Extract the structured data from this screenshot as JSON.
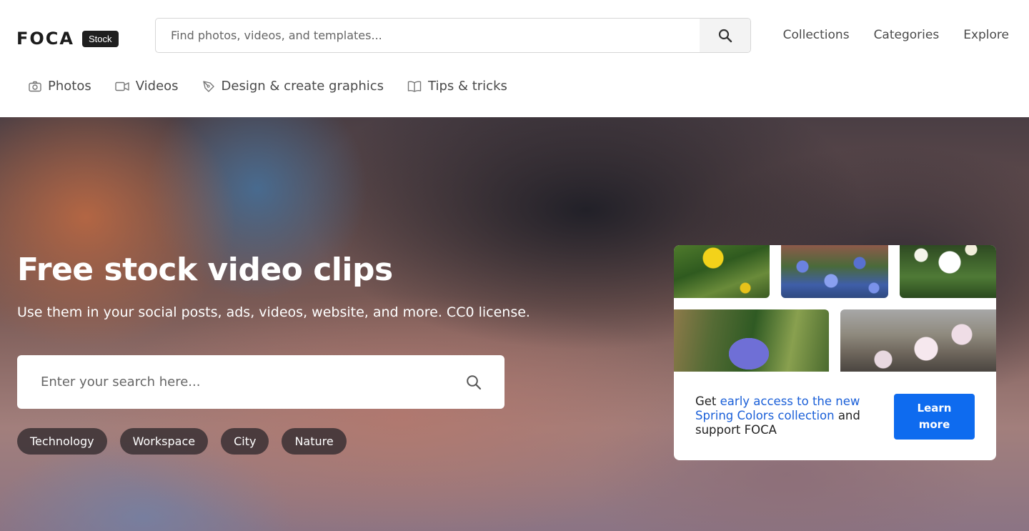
{
  "header": {
    "logo_text": "FOCA",
    "logo_badge": "Stock",
    "search_placeholder": "Find photos, videos, and templates...",
    "nav": [
      "Collections",
      "Categories",
      "Explore"
    ],
    "subnav": [
      {
        "label": "Photos",
        "icon": "camera-icon"
      },
      {
        "label": "Videos",
        "icon": "video-icon"
      },
      {
        "label": "Design & create graphics",
        "icon": "pen-icon"
      },
      {
        "label": "Tips & tricks",
        "icon": "book-icon"
      }
    ]
  },
  "hero": {
    "title": "Free stock video clips",
    "subtitle": "Use them in your social posts, ads, videos, website, and more. CC0 license.",
    "search_placeholder": "Enter your search here...",
    "tags": [
      "Technology",
      "Workspace",
      "City",
      "Nature"
    ]
  },
  "promo": {
    "text_pre": "Get ",
    "text_link": "early access to the new Spring Colors collection",
    "text_post": " and support FOCA",
    "button": "Learn more",
    "accent_color": "#0e6bef"
  }
}
